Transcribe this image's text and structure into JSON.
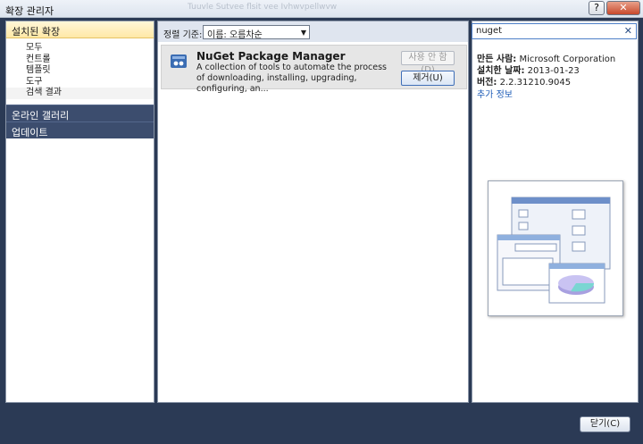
{
  "window": {
    "title": "확장 관리자",
    "faded_caption": "Tuuvle Sutvee flsit vee Ivhwvpellwvw",
    "help_label": "?",
    "close_label": "✕"
  },
  "left_nav": {
    "installed_label": "설치된 확장",
    "tree_items": [
      "모두",
      "컨트롤",
      "템플릿",
      "도구",
      "검색 결과"
    ],
    "online_gallery_label": "온라인 갤러리",
    "updates_label": "업데이트"
  },
  "sort": {
    "label": "정렬 기준:",
    "value": "이름: 오름차순"
  },
  "search": {
    "value": "nuget",
    "clear_icon": "✕"
  },
  "extension": {
    "name": "NuGet Package Manager",
    "description": "A collection of tools to automate the process of downloading, installing, upgrading, configuring, an...",
    "disable_label": "사용 안 함(D)",
    "remove_label": "제거(U)",
    "icon": "package-icon"
  },
  "details": {
    "author_label": "만든 사람:",
    "author_value": "Microsoft Corporation",
    "install_date_label": "설치한 날짜:",
    "install_date_value": "2013-01-23",
    "version_label": "버전:",
    "version_value": "2.2.31210.9045",
    "more_info_label": "추가 정보"
  },
  "footer": {
    "close_label": "닫기(C)"
  }
}
